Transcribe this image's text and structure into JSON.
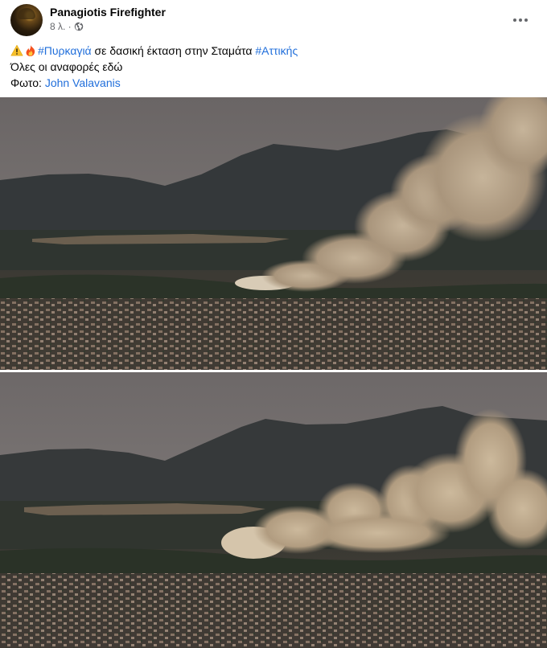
{
  "post": {
    "author": "Panagiotis Firefighter",
    "time": "8 λ. ·",
    "text": {
      "line1": {
        "emoji1": "warning-emoji",
        "emoji2": "fire-emoji",
        "hashtag1": "#Πυρκαγιά",
        "middle": " σε δασική έκταση στην Σταμάτα ",
        "hashtag2": "#Αττικής"
      },
      "line2": "Όλες οι αναφορές εδώ",
      "line3": {
        "prefix": "Φωτο: ",
        "mention": "John Valavanis"
      }
    },
    "photos": [
      {
        "subject": "wildfire smoke over hills above town"
      },
      {
        "subject": "wildfire smoke over hills above town, later frame"
      }
    ]
  },
  "icons": {
    "privacy": "globe-icon",
    "more": "more-horizontal-icon"
  },
  "colors": {
    "link": "#216fdb",
    "secondary_text": "#65676b",
    "smoke": "#bca98d",
    "sky": "#6f6a6a"
  }
}
